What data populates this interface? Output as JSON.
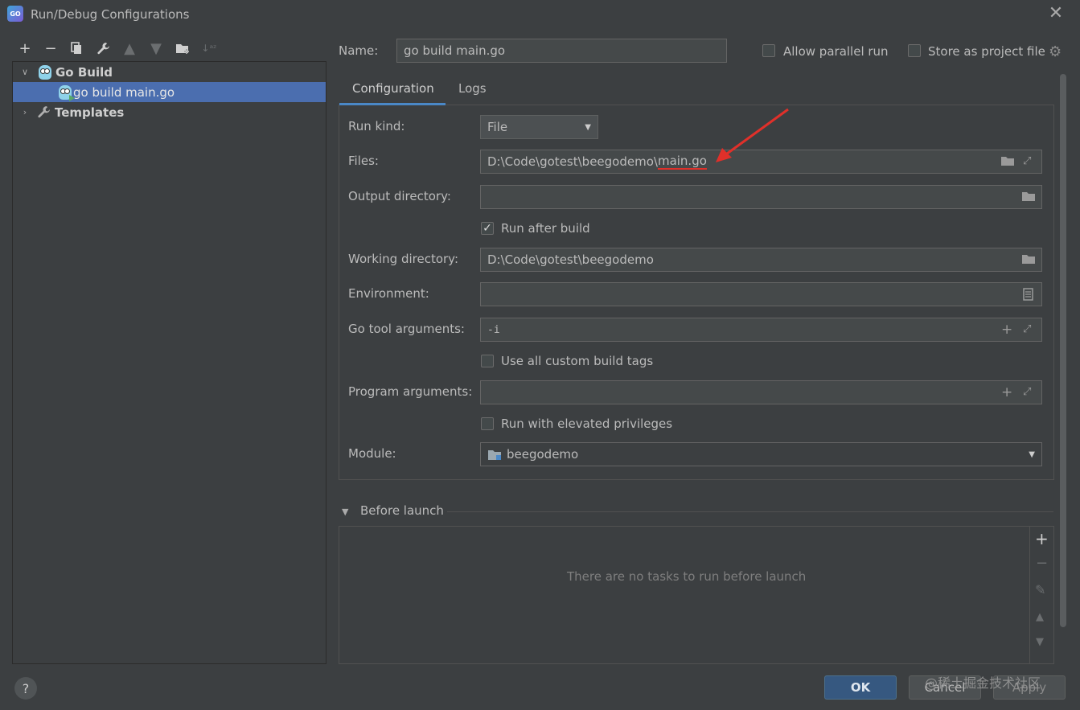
{
  "window": {
    "title": "Run/Debug Configurations",
    "app_icon_text": "GO"
  },
  "toolbar": {
    "items": [
      "add-icon",
      "remove-icon",
      "copy-icon",
      "wrench-icon",
      "move-up-icon",
      "move-down-icon",
      "new-folder-icon",
      "sort-icon"
    ]
  },
  "tree": {
    "go_build": "Go Build",
    "config_item": "go build main.go",
    "templates": "Templates"
  },
  "header": {
    "name_label": "Name:",
    "name_value": "go build main.go",
    "allow_parallel_run": "Allow parallel run",
    "store_as_project_file": "Store as project file"
  },
  "tabs": {
    "configuration": "Configuration",
    "logs": "Logs"
  },
  "form": {
    "run_kind_label": "Run kind:",
    "run_kind_value": "File",
    "files_label": "Files:",
    "files_value_prefix": "D:\\Code\\gotest\\beegodemo\\",
    "files_value_highlight": "main.go",
    "output_directory_label": "Output directory:",
    "output_directory_value": "",
    "run_after_build": "Run after build",
    "working_directory_label": "Working directory:",
    "working_directory_value": "D:\\Code\\gotest\\beegodemo",
    "environment_label": "Environment:",
    "environment_value": "",
    "go_tool_arguments_label": "Go tool arguments:",
    "go_tool_arguments_value": "-i",
    "use_all_custom_build_tags": "Use all custom build tags",
    "program_arguments_label": "Program arguments:",
    "program_arguments_value": "",
    "run_with_elevated_privileges": "Run with elevated privileges",
    "module_label": "Module:",
    "module_value": "beegodemo"
  },
  "before_launch": {
    "title": "Before launch",
    "empty_text": "There are no tasks to run before launch"
  },
  "buttons": {
    "ok": "OK",
    "cancel": "Cancel",
    "apply": "Apply"
  },
  "watermark": "@稀土掘金技术社区",
  "colors": {
    "background": "#3c3f41",
    "field": "#45494a",
    "selection": "#4b6eaf",
    "ok_button": "#365880",
    "annotation": "#e0302a"
  }
}
